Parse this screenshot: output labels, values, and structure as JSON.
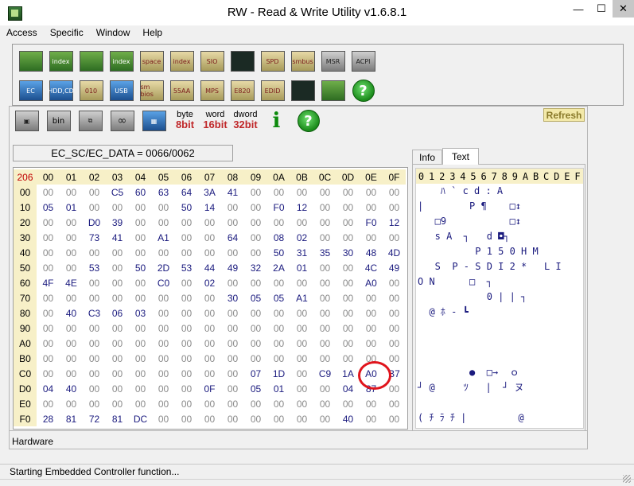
{
  "window": {
    "title": "RW - Read & Write Utility v1.6.8.1",
    "min_glyph": "—",
    "max_glyph": "☐",
    "close_glyph": "✕"
  },
  "menu": [
    "Access",
    "Specific",
    "Window",
    "Help"
  ],
  "toolbar_row1": [
    {
      "icon": "pci-icon",
      "label": ""
    },
    {
      "icon": "pci-index-icon",
      "label": "index"
    },
    {
      "icon": "memory-icon",
      "label": ""
    },
    {
      "icon": "memory-index-icon",
      "label": "index"
    },
    {
      "icon": "io-space-icon",
      "label": "space"
    },
    {
      "icon": "io-index-icon",
      "label": "index"
    },
    {
      "icon": "super-io-icon",
      "label": "SIO"
    },
    {
      "icon": "oscilloscope-icon",
      "label": ""
    },
    {
      "icon": "spd-icon",
      "label": "SPD"
    },
    {
      "icon": "smbus-icon",
      "label": "smbus"
    },
    {
      "icon": "msr-icon",
      "label": "MSR"
    },
    {
      "icon": "acpi-icon",
      "label": "ACPI"
    }
  ],
  "toolbar_row2": [
    {
      "icon": "ec-icon",
      "label": "EC"
    },
    {
      "icon": "hdd-cd-icon",
      "label": "HDD,CD"
    },
    {
      "icon": "cmos-icon",
      "label": "010"
    },
    {
      "icon": "usb-icon",
      "label": "USB"
    },
    {
      "icon": "smbios-icon",
      "label": "sm bios"
    },
    {
      "icon": "55aa-icon",
      "label": "55AA"
    },
    {
      "icon": "mps-icon",
      "label": "MPS"
    },
    {
      "icon": "e820-icon",
      "label": "E820"
    },
    {
      "icon": "edid-icon",
      "label": "EDID"
    },
    {
      "icon": "command-icon",
      "label": ""
    },
    {
      "icon": "pc-icon",
      "label": ""
    },
    {
      "icon": "help-icon",
      "label": "?"
    }
  ],
  "toolbar_secondary": {
    "width_buttons": [
      {
        "top": "byte",
        "bottom": "8bit",
        "color": "#c0282a"
      },
      {
        "top": "word",
        "bottom": "16bit",
        "color": "#c0282a"
      },
      {
        "top": "dword",
        "bottom": "32bit",
        "color": "#c0282a"
      }
    ],
    "info_label": "i",
    "help_label": "?"
  },
  "refresh_label": "Refresh",
  "ec_label": "EC_SC/EC_DATA = 0066/0062",
  "hex": {
    "corner": "206",
    "col_headers": [
      "00",
      "01",
      "02",
      "03",
      "04",
      "05",
      "06",
      "07",
      "08",
      "09",
      "0A",
      "0B",
      "0C",
      "0D",
      "0E",
      "0F"
    ],
    "rows": [
      {
        "addr": "00",
        "cells": [
          "00",
          "00",
          "00",
          "C5",
          "60",
          "63",
          "64",
          "3A",
          "41",
          "00",
          "00",
          "00",
          "00",
          "00",
          "00",
          "00"
        ]
      },
      {
        "addr": "10",
        "cells": [
          "05",
          "01",
          "00",
          "00",
          "00",
          "00",
          "50",
          "14",
          "00",
          "00",
          "F0",
          "12",
          "00",
          "00",
          "00",
          "00"
        ]
      },
      {
        "addr": "20",
        "cells": [
          "00",
          "00",
          "D0",
          "39",
          "00",
          "00",
          "00",
          "00",
          "00",
          "00",
          "00",
          "00",
          "00",
          "00",
          "F0",
          "12"
        ]
      },
      {
        "addr": "30",
        "cells": [
          "00",
          "00",
          "73",
          "41",
          "00",
          "A1",
          "00",
          "00",
          "64",
          "00",
          "08",
          "02",
          "00",
          "00",
          "00",
          "00"
        ]
      },
      {
        "addr": "40",
        "cells": [
          "00",
          "00",
          "00",
          "00",
          "00",
          "00",
          "00",
          "00",
          "00",
          "00",
          "50",
          "31",
          "35",
          "30",
          "48",
          "4D"
        ]
      },
      {
        "addr": "50",
        "cells": [
          "00",
          "00",
          "53",
          "00",
          "50",
          "2D",
          "53",
          "44",
          "49",
          "32",
          "2A",
          "01",
          "00",
          "00",
          "4C",
          "49"
        ]
      },
      {
        "addr": "60",
        "cells": [
          "4F",
          "4E",
          "00",
          "00",
          "00",
          "C0",
          "00",
          "02",
          "00",
          "00",
          "00",
          "00",
          "00",
          "00",
          "A0",
          "00"
        ]
      },
      {
        "addr": "70",
        "cells": [
          "00",
          "00",
          "00",
          "00",
          "00",
          "00",
          "00",
          "00",
          "30",
          "05",
          "05",
          "A1",
          "00",
          "00",
          "00",
          "00"
        ]
      },
      {
        "addr": "80",
        "cells": [
          "00",
          "40",
          "C3",
          "06",
          "03",
          "00",
          "00",
          "00",
          "00",
          "00",
          "00",
          "00",
          "00",
          "00",
          "00",
          "00"
        ]
      },
      {
        "addr": "90",
        "cells": [
          "00",
          "00",
          "00",
          "00",
          "00",
          "00",
          "00",
          "00",
          "00",
          "00",
          "00",
          "00",
          "00",
          "00",
          "00",
          "00"
        ]
      },
      {
        "addr": "A0",
        "cells": [
          "00",
          "00",
          "00",
          "00",
          "00",
          "00",
          "00",
          "00",
          "00",
          "00",
          "00",
          "00",
          "00",
          "00",
          "00",
          "00"
        ]
      },
      {
        "addr": "B0",
        "cells": [
          "00",
          "00",
          "00",
          "00",
          "00",
          "00",
          "00",
          "00",
          "00",
          "00",
          "00",
          "00",
          "00",
          "00",
          "00",
          "00"
        ]
      },
      {
        "addr": "C0",
        "cells": [
          "00",
          "00",
          "00",
          "00",
          "00",
          "00",
          "00",
          "00",
          "00",
          "07",
          "1D",
          "00",
          "C9",
          "1A",
          "A0",
          "B7"
        ]
      },
      {
        "addr": "D0",
        "cells": [
          "04",
          "40",
          "00",
          "00",
          "00",
          "00",
          "00",
          "0F",
          "00",
          "05",
          "01",
          "00",
          "00",
          "04",
          "87",
          "00"
        ]
      },
      {
        "addr": "E0",
        "cells": [
          "00",
          "00",
          "00",
          "00",
          "00",
          "00",
          "00",
          "00",
          "00",
          "00",
          "00",
          "00",
          "00",
          "00",
          "00",
          "00"
        ]
      },
      {
        "addr": "F0",
        "cells": [
          "28",
          "81",
          "72",
          "81",
          "DC",
          "00",
          "00",
          "00",
          "00",
          "00",
          "00",
          "00",
          "00",
          "40",
          "00",
          "00"
        ]
      }
    ]
  },
  "tabs": [
    {
      "label": "Info"
    },
    {
      "label": "Text"
    }
  ],
  "text_panel": {
    "header": [
      "0",
      "1",
      "2",
      "3",
      "4",
      "5",
      "6",
      "7",
      "8",
      "9",
      "A",
      "B",
      "C",
      "D",
      "E",
      "F"
    ],
    "lines": [
      "    ﾊ ` c d : A    ",
      "|        P ¶    □↕",
      "   □9           □↕",
      "   s A  ┐   d ◘┐  ",
      "          P 1 5 0 H M",
      "   S  P - S D I 2 *   L I",
      "O N      □  ┐      ",
      "            0 | | ┐",
      "  @ ﾎ - ┗         ",
      "                 ",
      "                 ",
      "                 ",
      "         ●  □→  ｏ",
      "┘ @     ﾂ   |  ┘ ヌ",
      "                 ",
      "( ﾁ ﾗ ﾁ |         @"
    ]
  },
  "hardware_label": "Hardware",
  "status": "Starting Embedded Controller function..."
}
